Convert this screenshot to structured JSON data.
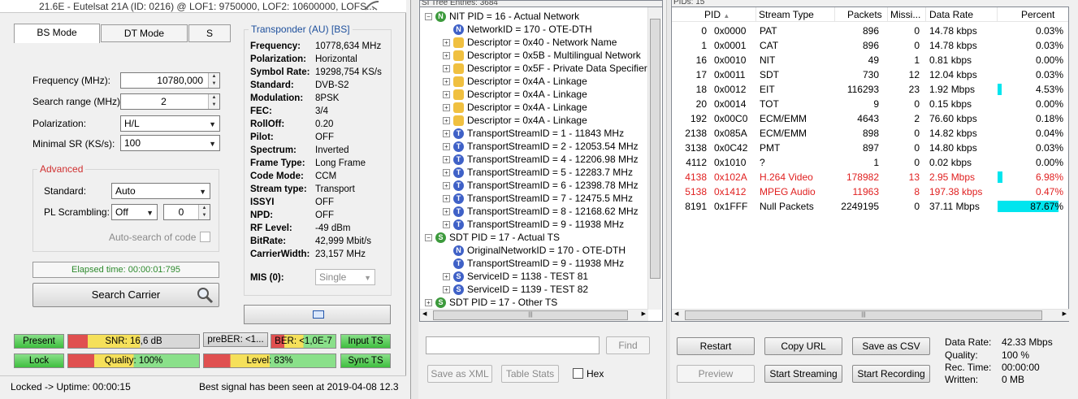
{
  "window": {
    "title": "21.6E - Eutelsat 21A (ID: 0216) @ LOF1: 9750000, LOF2: 10600000, LOFS..."
  },
  "tabs": [
    {
      "label": "BS Mode",
      "active": true
    },
    {
      "label": "DT Mode",
      "active": false
    },
    {
      "label": "S",
      "active": false
    }
  ],
  "search": {
    "frequency_label": "Frequency (MHz):",
    "frequency_value": "10780,000",
    "range_label": "Search range (MHz):",
    "range_value": "2",
    "polarization_label": "Polarization:",
    "polarization_value": "H/L",
    "minsr_label": "Minimal SR (KS/s):",
    "minsr_value": "100"
  },
  "advanced": {
    "title": "Advanced",
    "standard_label": "Standard:",
    "standard_value": "Auto",
    "pl_label": "PL Scrambling:",
    "pl_value": "Off",
    "pl_number": "0",
    "autosearch_label": "Auto-search of code"
  },
  "elapsed": "Elapsed time: 00:00:01:795",
  "search_button": "Search Carrier",
  "transponder": {
    "title": "Transponder (AU) [BS]",
    "rows": [
      {
        "k": "Frequency:",
        "v": "10778,634 MHz"
      },
      {
        "k": "Polarization:",
        "v": "Horizontal"
      },
      {
        "k": "Symbol Rate:",
        "v": "19298,754 KS/s"
      },
      {
        "k": "Standard:",
        "v": "DVB-S2"
      },
      {
        "k": "Modulation:",
        "v": "8PSK"
      },
      {
        "k": "FEC:",
        "v": "3/4"
      },
      {
        "k": "RollOff:",
        "v": "0.20"
      },
      {
        "k": "Pilot:",
        "v": "OFF"
      },
      {
        "k": "Spectrum:",
        "v": "Inverted"
      },
      {
        "k": "Frame Type:",
        "v": "Long Frame"
      },
      {
        "k": "Code Mode:",
        "v": "CCM"
      },
      {
        "k": "Stream type:",
        "v": "Transport"
      },
      {
        "k": "ISSYI",
        "v": "OFF"
      },
      {
        "k": "NPD:",
        "v": "OFF"
      },
      {
        "k": "RF Level:",
        "v": "-49 dBm"
      },
      {
        "k": "BitRate:",
        "v": "42,999 Mbit/s"
      },
      {
        "k": "CarrierWidth:",
        "v": "23,157 MHz"
      }
    ],
    "mis_label": "MIS (0):",
    "mis_value": "Single"
  },
  "indicators": {
    "present": "Present",
    "snr": "SNR: 16,6 dB",
    "preber": "preBER: <1...",
    "ber": "BER: <1,0E-7",
    "input_ts": "Input TS",
    "lock": "Lock",
    "quality": "Quality: 100%",
    "level": "Level: 83%",
    "sync_ts": "Sync TS"
  },
  "status": {
    "left": "Locked -> Uptime: 00:00:15",
    "right": "Best signal has been seen at 2019-04-08 12.3"
  },
  "tree": {
    "header": "SI Tree Entries: 3684",
    "rows": [
      {
        "lvl": 0,
        "exp": "-",
        "icon": "N",
        "text": "NIT PID = 16 - Actual Network"
      },
      {
        "lvl": 1,
        "exp": "",
        "icon": "Nb",
        "text": "NetworkID = 170 - OTE-DTH"
      },
      {
        "lvl": 1,
        "exp": "+",
        "icon": "D",
        "text": "Descriptor = 0x40 - Network Name"
      },
      {
        "lvl": 1,
        "exp": "+",
        "icon": "D",
        "text": "Descriptor = 0x5B - Multilingual Network"
      },
      {
        "lvl": 1,
        "exp": "+",
        "icon": "D",
        "text": "Descriptor = 0x5F - Private Data Specifier"
      },
      {
        "lvl": 1,
        "exp": "+",
        "icon": "D",
        "text": "Descriptor = 0x4A - Linkage"
      },
      {
        "lvl": 1,
        "exp": "+",
        "icon": "D",
        "text": "Descriptor = 0x4A - Linkage"
      },
      {
        "lvl": 1,
        "exp": "+",
        "icon": "D",
        "text": "Descriptor = 0x4A - Linkage"
      },
      {
        "lvl": 1,
        "exp": "+",
        "icon": "D",
        "text": "Descriptor = 0x4A - Linkage"
      },
      {
        "lvl": 1,
        "exp": "+",
        "icon": "T",
        "text": "TransportStreamID = 1 - 11843 MHz"
      },
      {
        "lvl": 1,
        "exp": "+",
        "icon": "T",
        "text": "TransportStreamID = 2 - 12053.54 MHz"
      },
      {
        "lvl": 1,
        "exp": "+",
        "icon": "T",
        "text": "TransportStreamID = 4 - 12206.98 MHz"
      },
      {
        "lvl": 1,
        "exp": "+",
        "icon": "T",
        "text": "TransportStreamID = 5 - 12283.7 MHz"
      },
      {
        "lvl": 1,
        "exp": "+",
        "icon": "T",
        "text": "TransportStreamID = 6 - 12398.78 MHz"
      },
      {
        "lvl": 1,
        "exp": "+",
        "icon": "T",
        "text": "TransportStreamID = 7 - 12475.5 MHz"
      },
      {
        "lvl": 1,
        "exp": "+",
        "icon": "T",
        "text": "TransportStreamID = 8 - 12168.62 MHz"
      },
      {
        "lvl": 1,
        "exp": "+",
        "icon": "T",
        "text": "TransportStreamID = 9 - 11938 MHz"
      },
      {
        "lvl": 0,
        "exp": "-",
        "icon": "S",
        "text": "SDT PID = 17 - Actual TS"
      },
      {
        "lvl": 1,
        "exp": "",
        "icon": "Nb",
        "text": "OriginalNetworkID = 170 - OTE-DTH"
      },
      {
        "lvl": 1,
        "exp": "",
        "icon": "T",
        "text": "TransportStreamID = 9 - 11938 MHz"
      },
      {
        "lvl": 1,
        "exp": "+",
        "icon": "Sb",
        "text": "ServiceID = 1138 - TEST 81"
      },
      {
        "lvl": 1,
        "exp": "+",
        "icon": "Sb",
        "text": "ServiceID = 1139 - TEST 82"
      },
      {
        "lvl": 0,
        "exp": "+",
        "icon": "S",
        "text": "SDT PID = 17 - Other TS"
      }
    ]
  },
  "tree_controls": {
    "find_button": "Find",
    "save_xml": "Save as XML",
    "table_stats": "Table Stats",
    "hex_label": "Hex"
  },
  "pids": {
    "header": "PIDs: 15",
    "columns": [
      "PID",
      "Stream Type",
      "Packets",
      "Missi...",
      "Data Rate",
      "Percent"
    ],
    "rows": [
      {
        "dec": "0",
        "hex": "0x0000",
        "type": "PAT",
        "packets": "896",
        "missing": "0",
        "rate": "14.78 kbps",
        "pct": "0.03%",
        "pct_val": 0.03,
        "red": false
      },
      {
        "dec": "1",
        "hex": "0x0001",
        "type": "CAT",
        "packets": "896",
        "missing": "0",
        "rate": "14.78 kbps",
        "pct": "0.03%",
        "pct_val": 0.03,
        "red": false
      },
      {
        "dec": "16",
        "hex": "0x0010",
        "type": "NIT",
        "packets": "49",
        "missing": "1",
        "rate": "0.81 kbps",
        "pct": "0.00%",
        "pct_val": 0.0,
        "red": false
      },
      {
        "dec": "17",
        "hex": "0x0011",
        "type": "SDT",
        "packets": "730",
        "missing": "12",
        "rate": "12.04 kbps",
        "pct": "0.03%",
        "pct_val": 0.03,
        "red": false
      },
      {
        "dec": "18",
        "hex": "0x0012",
        "type": "EIT",
        "packets": "116293",
        "missing": "23",
        "rate": "1.92 Mbps",
        "pct": "4.53%",
        "pct_val": 4.53,
        "red": false
      },
      {
        "dec": "20",
        "hex": "0x0014",
        "type": "TOT",
        "packets": "9",
        "missing": "0",
        "rate": "0.15 kbps",
        "pct": "0.00%",
        "pct_val": 0.0,
        "red": false
      },
      {
        "dec": "192",
        "hex": "0x00C0",
        "type": "ECM/EMM",
        "packets": "4643",
        "missing": "2",
        "rate": "76.60 kbps",
        "pct": "0.18%",
        "pct_val": 0.18,
        "red": false
      },
      {
        "dec": "2138",
        "hex": "0x085A",
        "type": "ECM/EMM",
        "packets": "898",
        "missing": "0",
        "rate": "14.82 kbps",
        "pct": "0.04%",
        "pct_val": 0.04,
        "red": false
      },
      {
        "dec": "3138",
        "hex": "0x0C42",
        "type": "PMT",
        "packets": "897",
        "missing": "0",
        "rate": "14.80 kbps",
        "pct": "0.03%",
        "pct_val": 0.03,
        "red": false
      },
      {
        "dec": "4112",
        "hex": "0x1010",
        "type": "?",
        "packets": "1",
        "missing": "0",
        "rate": "0.02 kbps",
        "pct": "0.00%",
        "pct_val": 0.0,
        "red": false
      },
      {
        "dec": "4138",
        "hex": "0x102A",
        "type": "H.264 Video",
        "packets": "178982",
        "missing": "13",
        "rate": "2.95 Mbps",
        "pct": "6.98%",
        "pct_val": 6.98,
        "red": true
      },
      {
        "dec": "5138",
        "hex": "0x1412",
        "type": "MPEG Audio",
        "packets": "11963",
        "missing": "8",
        "rate": "197.38 kbps",
        "pct": "0.47%",
        "pct_val": 0.47,
        "red": true
      },
      {
        "dec": "8191",
        "hex": "0x1FFF",
        "type": "Null Packets",
        "packets": "2249195",
        "missing": "0",
        "rate": "37.11 Mbps",
        "pct": "87.67%",
        "pct_val": 87.67,
        "red": false
      }
    ]
  },
  "pid_controls": {
    "restart": "Restart",
    "copy_url": "Copy URL",
    "save_csv": "Save as CSV",
    "preview": "Preview",
    "start_streaming": "Start Streaming",
    "start_recording": "Start Recording"
  },
  "stats": {
    "rate_label": "Data Rate:",
    "rate_value": "42.33 Mbps",
    "quality_label": "Quality:",
    "quality_value": "100 %",
    "rectime_label": "Rec. Time:",
    "rectime_value": "00:00:00",
    "written_label": "Written:",
    "written_value": "0 MB"
  },
  "colors": {
    "accent_red": "#e02020",
    "percent_bar": "#00e5ee",
    "advanced_title": "#d03030",
    "transponder_title": "#1d4f9c",
    "elapsed_text": "#2d8a2d"
  }
}
